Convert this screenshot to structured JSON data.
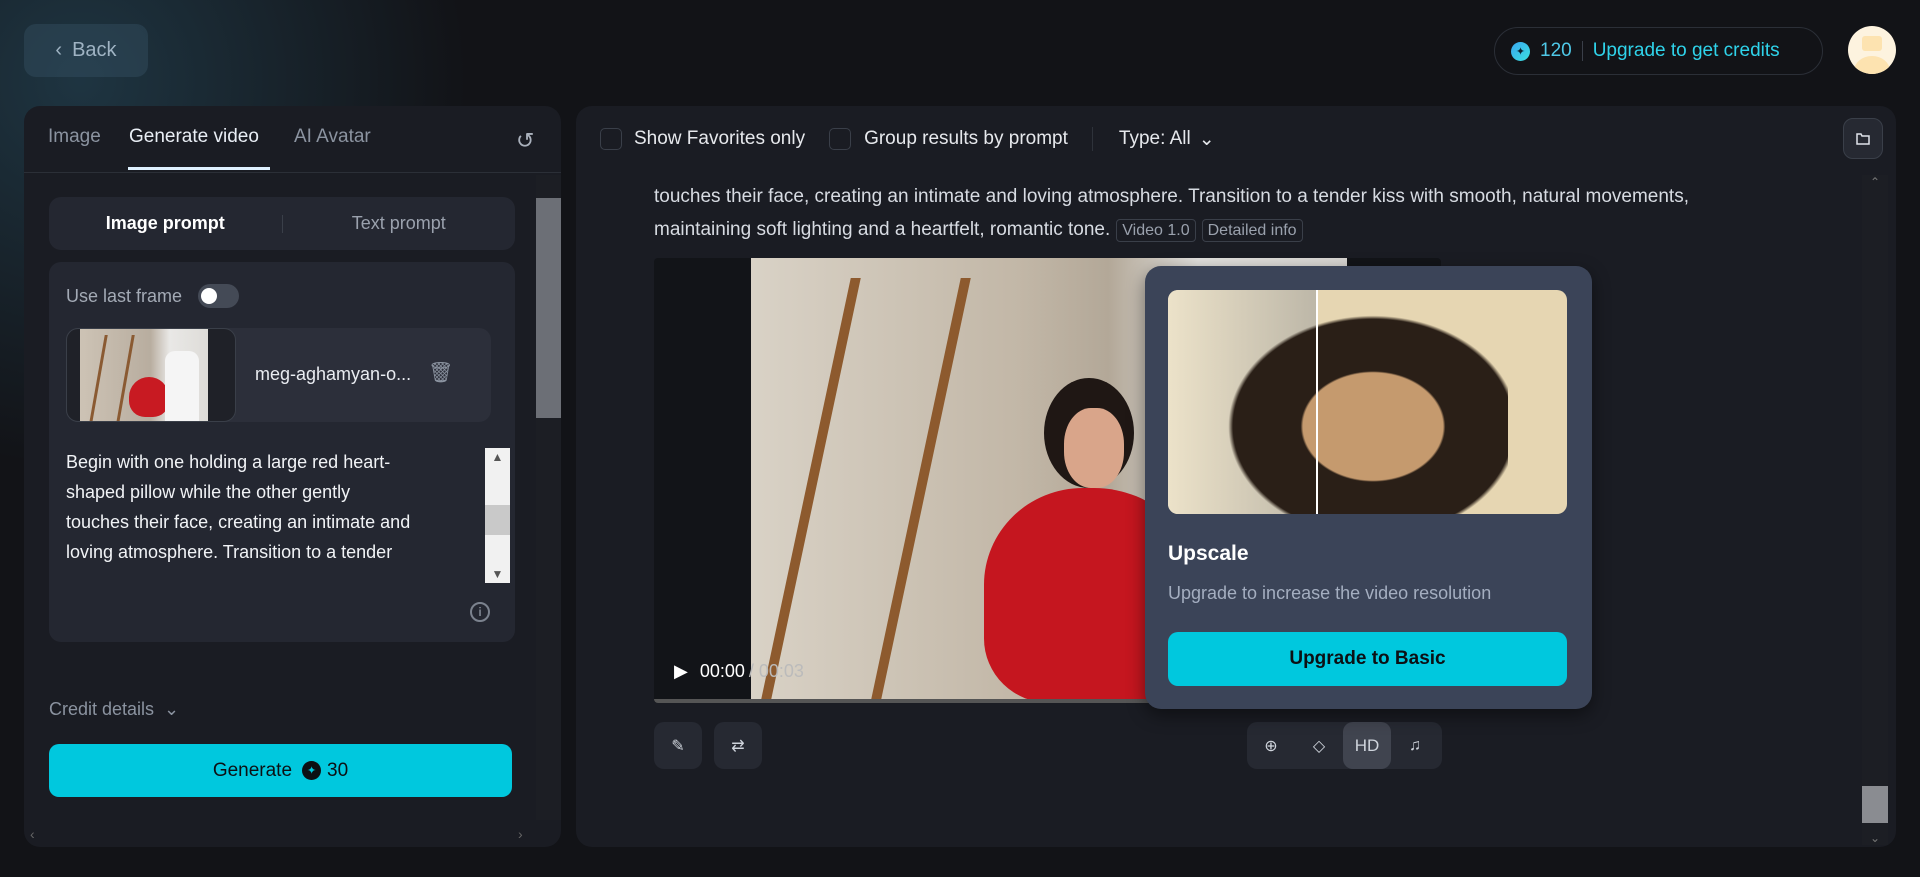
{
  "header": {
    "back_label": "Back",
    "credits": "120",
    "upgrade_label": "Upgrade to get credits"
  },
  "left": {
    "tabs": [
      {
        "label": "Image"
      },
      {
        "label": "Generate video"
      },
      {
        "label": "AI Avatar"
      }
    ],
    "segments": [
      {
        "label": "Image prompt"
      },
      {
        "label": "Text prompt"
      }
    ],
    "use_last_frame_label": "Use last frame",
    "use_last_frame": false,
    "file_name": "meg-aghamyan-o...",
    "prompt_lines": [
      "Begin with one holding a large red heart-",
      "shaped pillow while the other gently",
      "touches their face, creating an intimate and",
      "loving atmosphere. Transition to a tender"
    ],
    "credit_details_label": "Credit details",
    "generate_label": "Generate",
    "generate_cost": "30"
  },
  "right": {
    "show_favorites_label": "Show Favorites only",
    "group_label": "Group results by prompt",
    "type_label": "Type: All",
    "prompt_line1": "touches their face, creating an intimate and loving atmosphere. Transition to a tender kiss with smooth, natural movements,",
    "prompt_line2": "maintaining soft lighting and a heartfelt, romantic tone.",
    "tag_model": "Video 1.0",
    "tag_info": "Detailed info",
    "time_current": "00:00",
    "time_total": "/ 00:03",
    "hd_label": "HD"
  },
  "popover": {
    "title": "Upscale",
    "subtitle": "Upgrade to increase the video resolution",
    "button": "Upgrade to Basic"
  }
}
